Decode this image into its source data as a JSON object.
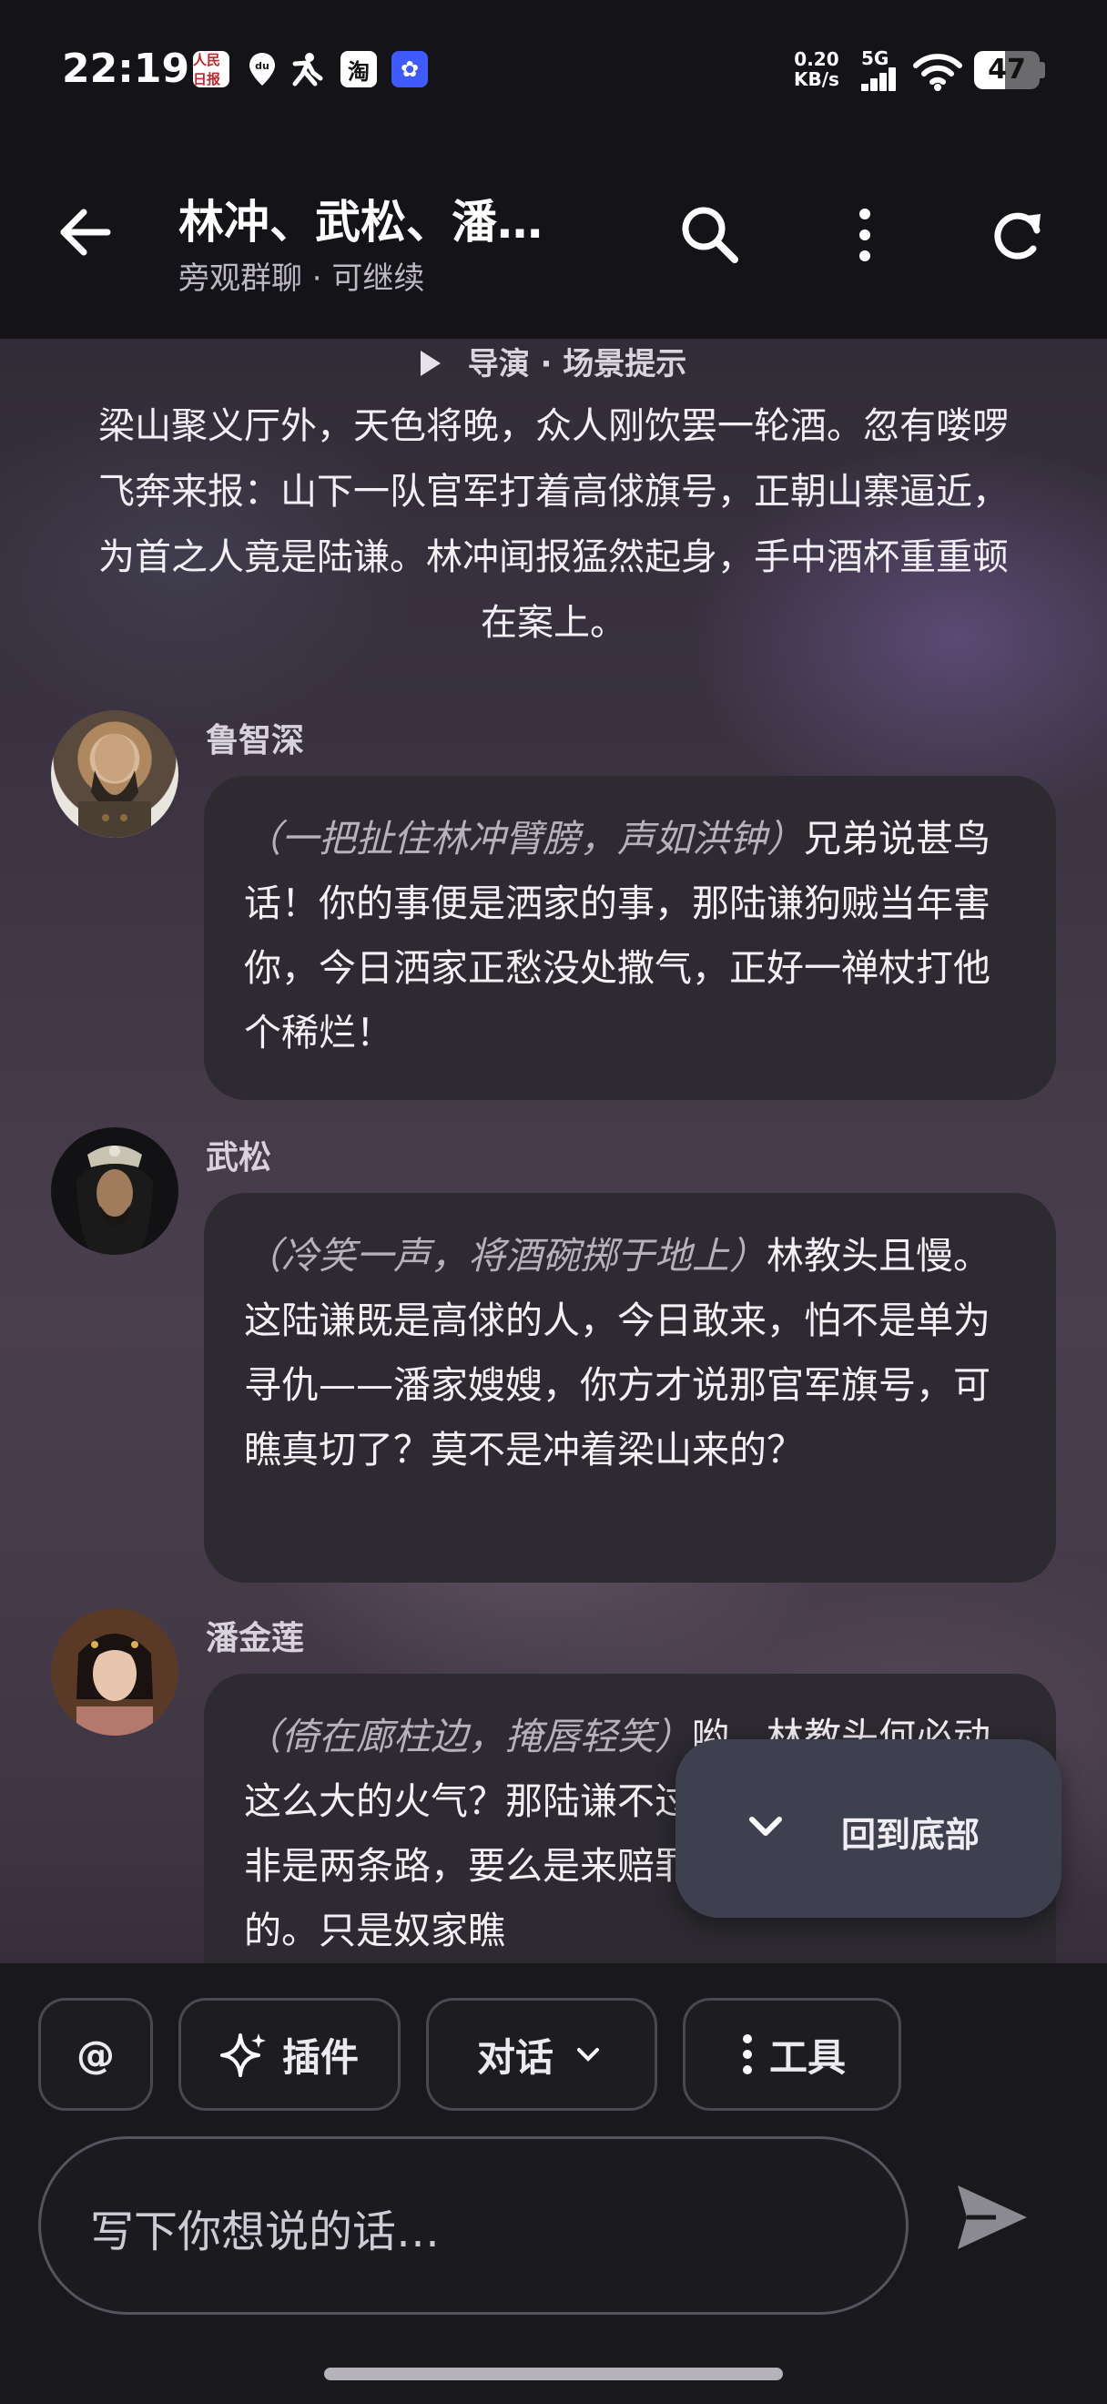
{
  "status_bar": {
    "time": "22:19",
    "app_icons": [
      "人民日报",
      "du",
      "⛉",
      "淘",
      "✿"
    ],
    "network_speed_value": "0.20",
    "network_speed_unit": "KB/s",
    "signal_label": "5G",
    "battery_level": "47",
    "battery_fraction": 0.47
  },
  "header": {
    "title": "林冲、武松、潘…",
    "subtitle": "旁观群聊 · 可继续",
    "icons": [
      "back-arrow-icon",
      "search-icon",
      "more-vert-icon",
      "refresh-icon"
    ]
  },
  "director": {
    "label": "导演 · 场景提示",
    "text": "梁山聚义厅外，天色将晚，众人刚饮罢一轮酒。忽有喽啰飞奔来报：山下一队官军打着高俅旗号，正朝山寨逼近，为首之人竟是陆谦。林冲闻报猛然起身，手中酒杯重重顿在案上。"
  },
  "messages": [
    {
      "speaker": "鲁智深",
      "action": "（一把扯住林冲臂膀，声如洪钟）",
      "text": "兄弟说甚鸟话！你的事便是洒家的事，那陆谦狗贼当年害你，今日洒家正愁没处撒气，正好一禅杖打他个稀烂！"
    },
    {
      "speaker": "武松",
      "action": "（冷笑一声，将酒碗掷于地上）",
      "text": "林教头且慢。这陆谦既是高俅的人，今日敢来，怕不是单为寻仇——潘家嫂嫂，你方才说那官军旗号，可瞧真切了？莫不是冲着梁山来的？"
    },
    {
      "speaker": "潘金莲",
      "action": "（倚在廊柱边，掩唇轻笑）",
      "text": "哟，林教头何必动这么大的火气？那陆谦不过一条狗，今日来无非是两条路，要么是来赔罪，要么就是来讨死的。只是奴家瞧"
    }
  ],
  "scroll_to_bottom": {
    "label": "回到底部"
  },
  "toolbar": {
    "mention": "@",
    "plugins": "插件",
    "dialogue": "对话",
    "tools": "工具"
  },
  "composer": {
    "placeholder": "写下你想说的话…"
  },
  "colors": {
    "bar_background": "#141317",
    "bubble": "#2d2b31",
    "action_text": "#b7b1bd",
    "fab": "#3e4050"
  }
}
